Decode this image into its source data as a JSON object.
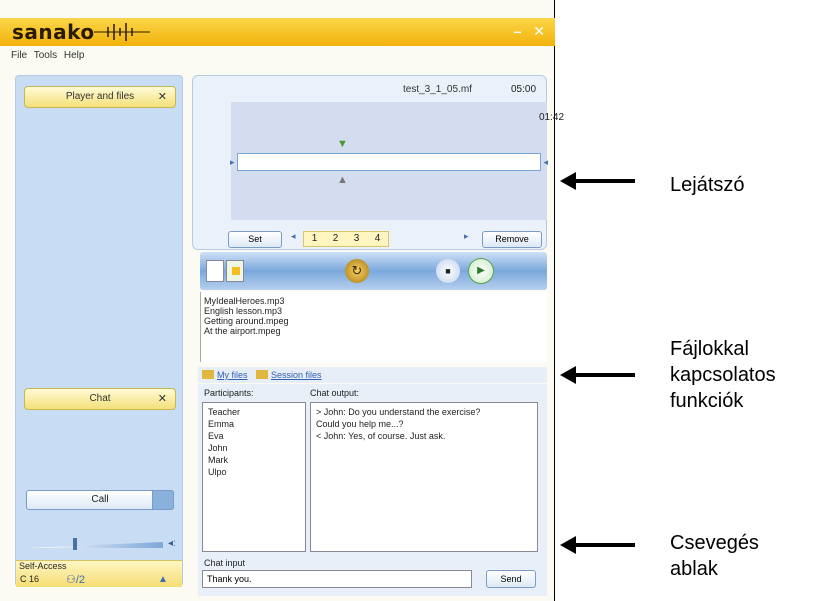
{
  "window": {
    "logo": "sanako",
    "minimize_label": "–",
    "close_label": "✕"
  },
  "menu": [
    "File",
    "Tools",
    "Help"
  ],
  "left_panel": {
    "player_files_label": "Player and files",
    "chat_label": "Chat",
    "close_glyph": "✕",
    "call_label": "Call",
    "volume_level_pct": 33,
    "speaker_glyph": "◂:",
    "self_access_title": "Self-Access",
    "self_access_value": "C 16",
    "self_access_icon": "⚇/2",
    "lock_glyph": "▲"
  },
  "player": {
    "file_name": "test_3_1_05.mf",
    "total_time": "05:00",
    "current_time": "01:42",
    "set_label": "Set",
    "remove_label": "Remove",
    "segments": [
      "1",
      "2",
      "3",
      "4"
    ],
    "seg_prev": "◂",
    "seg_next": "▸",
    "green_marker": "▼",
    "grey_marker": "▲"
  },
  "toolbar": {
    "record_glyph": "↻",
    "stop_glyph": "■",
    "play_glyph": "▶"
  },
  "playlist": [
    "MyIdealHeroes.mp3",
    "English lesson.mp3",
    "Getting around.mpeg",
    "At the airport.mpeg"
  ],
  "files_tabs": {
    "my_files": "My files",
    "session_files": "Session files"
  },
  "chat": {
    "participants_label": "Participants:",
    "chat_output_label": "Chat output:",
    "participants": [
      "Teacher",
      "Emma",
      "Eva",
      "John",
      "Mark",
      "Ulpo"
    ],
    "messages": [
      "> John: Do you understand the exercise?",
      "Could you help me...?",
      "< John: Yes, of course. Just ask."
    ],
    "chat_input_label": "Chat input",
    "chat_input_value": "Thank you.",
    "send_label": "Send"
  },
  "annotations": {
    "player": "Lejátszó",
    "files_line1": "Fájlokkal",
    "files_line2": "kapcsolatos",
    "files_line3": "funkciók",
    "chat_line1": "Csevegés",
    "chat_line2": "ablak"
  }
}
